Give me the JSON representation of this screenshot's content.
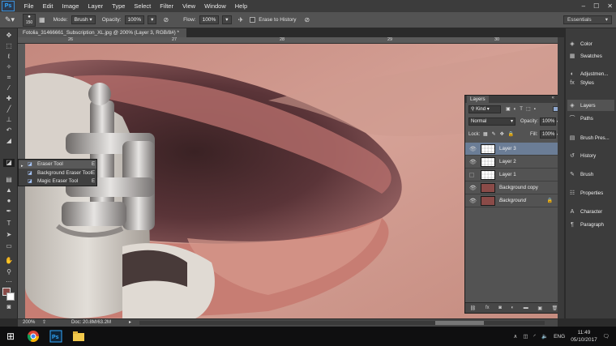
{
  "app": {
    "logo": "Ps"
  },
  "menu": [
    "File",
    "Edit",
    "Image",
    "Layer",
    "Type",
    "Select",
    "Filter",
    "View",
    "Window",
    "Help"
  ],
  "window_controls": [
    "–",
    "☐",
    "✕"
  ],
  "options": {
    "brush_size": "150",
    "mode_label": "Mode:",
    "mode_value": "Brush",
    "opacity_label": "Opacity:",
    "opacity_value": "100%",
    "flow_label": "Flow:",
    "flow_value": "100%",
    "erase_history_label": "Erase to History",
    "workspace": "Essentials"
  },
  "document": {
    "tab_title": "Fotolia_31466661_Subscription_XL.jpg @ 200% (Layer 3, RGB/8#) *",
    "close": "×",
    "ruler_ticks": [
      "26",
      "27",
      "28",
      "29",
      "30"
    ],
    "zoom": "200%",
    "doc_size": "Doc: 20.8M/63.2M"
  },
  "tool_flyout": {
    "items": [
      {
        "label": "Eraser Tool",
        "key": "E",
        "selected": true
      },
      {
        "label": "Background Eraser Tool",
        "key": "E",
        "selected": false
      },
      {
        "label": "Magic Eraser Tool",
        "key": "E",
        "selected": false
      }
    ]
  },
  "layers_panel": {
    "tab": "Layers",
    "filter_kind": "Kind",
    "blend_mode": "Normal",
    "opacity_label": "Opacity:",
    "opacity_value": "100%",
    "lock_label": "Lock:",
    "fill_label": "Fill:",
    "fill_value": "100%",
    "layers": [
      {
        "name": "Layer 3",
        "selected": true,
        "visible": true,
        "thumb": "transparent"
      },
      {
        "name": "Layer 2",
        "selected": false,
        "visible": true,
        "thumb": "transparent"
      },
      {
        "name": "Layer 1",
        "selected": false,
        "visible": false,
        "thumb": "transparent"
      },
      {
        "name": "Background copy",
        "selected": false,
        "visible": true,
        "thumb": "photo"
      },
      {
        "name": "Background",
        "selected": false,
        "visible": true,
        "thumb": "photo",
        "locked": true
      }
    ],
    "footer_icons": [
      "link-icon",
      "fx-icon",
      "mask-icon",
      "adjustment-icon",
      "folder-icon",
      "new-layer-icon",
      "trash-icon"
    ]
  },
  "right_panels": [
    {
      "label": "Color",
      "icon": "color-icon"
    },
    {
      "label": "Swatches",
      "icon": "swatches-icon"
    },
    {
      "label": "Adjustmen...",
      "icon": "adjustments-icon"
    },
    {
      "label": "Styles",
      "icon": "styles-icon"
    },
    {
      "label": "Layers",
      "icon": "layers-icon",
      "active": true
    },
    {
      "label": "Paths",
      "icon": "paths-icon"
    },
    {
      "label": "Brush Pres...",
      "icon": "brush-presets-icon"
    },
    {
      "label": "History",
      "icon": "history-icon"
    },
    {
      "label": "Brush",
      "icon": "brush-icon"
    },
    {
      "label": "Properties",
      "icon": "properties-icon"
    },
    {
      "label": "Character",
      "icon": "character-icon"
    },
    {
      "label": "Paragraph",
      "icon": "paragraph-icon"
    }
  ],
  "taskbar": {
    "language": "ENG",
    "time": "11:49",
    "date": "05/10/2017"
  },
  "colors": {
    "foreground": "#8a4b48",
    "background": "#ffffff",
    "selected_layer": "#6b7d96",
    "ps_blue": "#31a8ff"
  }
}
